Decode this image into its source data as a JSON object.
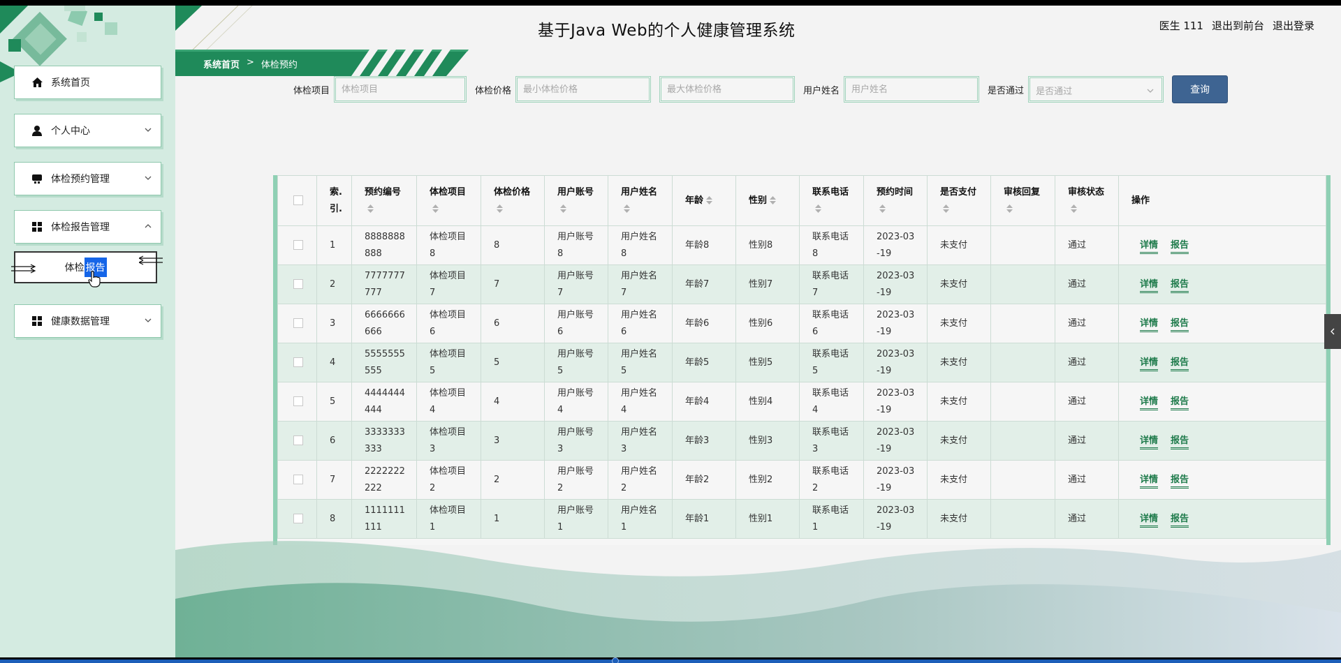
{
  "app": {
    "title": "基于Java Web的个人健康管理系统"
  },
  "header": {
    "user_label": "医生 111",
    "back_to_front": "退出到前台",
    "logout": "退出登录"
  },
  "colors": {
    "accent_green": "#1f8a5a",
    "sidebar_bg": "#d4ebe1",
    "query_button": "#3e6492",
    "link": "#1d7a4a"
  },
  "sidebar": {
    "items": [
      {
        "label": "系统首页",
        "icon": "home-icon"
      },
      {
        "label": "个人中心",
        "icon": "user-icon"
      },
      {
        "label": "体检预约管理",
        "icon": "calendar-icon"
      },
      {
        "label": "体检报告管理",
        "icon": "grid-icon"
      },
      {
        "label": "健康数据管理",
        "icon": "grid-icon"
      }
    ],
    "sub_item": {
      "label_prefix": "体检",
      "label_highlight": "报告"
    }
  },
  "breadcrumb": {
    "home": "系统首页",
    "separator": ">",
    "current": "体检预约"
  },
  "search": {
    "item_label": "体检项目",
    "item_placeholder": "体检项目",
    "price_label": "体检价格",
    "price_min_placeholder": "最小体检价格",
    "price_max_placeholder": "最大体检价格",
    "username_label": "用户姓名",
    "username_placeholder": "用户姓名",
    "passed_label": "是否通过",
    "passed_placeholder": "是否通过",
    "query_button": "查询"
  },
  "table": {
    "headers": [
      "索.引.",
      "预约编号",
      "体检项目",
      "体检价格",
      "用户账号",
      "用户姓名",
      "年龄",
      "性别",
      "联系电话",
      "预约时间",
      "是否支付",
      "审核回复",
      "审核状态",
      "操作"
    ],
    "detail_link": "详情",
    "report_link": "报告",
    "rows": [
      [
        "1",
        "8888888888",
        "体检项目8",
        "8",
        "用户账号8",
        "用户姓名8",
        "年龄8",
        "性别8",
        "联系电话8",
        "2023-03-19",
        "未支付",
        "",
        "通过"
      ],
      [
        "2",
        "7777777777",
        "体检项目7",
        "7",
        "用户账号7",
        "用户姓名7",
        "年龄7",
        "性别7",
        "联系电话7",
        "2023-03-19",
        "未支付",
        "",
        "通过"
      ],
      [
        "3",
        "6666666666",
        "体检项目6",
        "6",
        "用户账号6",
        "用户姓名6",
        "年龄6",
        "性别6",
        "联系电话6",
        "2023-03-19",
        "未支付",
        "",
        "通过"
      ],
      [
        "4",
        "5555555555",
        "体检项目5",
        "5",
        "用户账号5",
        "用户姓名5",
        "年龄5",
        "性别5",
        "联系电话5",
        "2023-03-19",
        "未支付",
        "",
        "通过"
      ],
      [
        "5",
        "4444444444",
        "体检项目4",
        "4",
        "用户账号4",
        "用户姓名4",
        "年龄4",
        "性别4",
        "联系电话4",
        "2023-03-19",
        "未支付",
        "",
        "通过"
      ],
      [
        "6",
        "3333333333",
        "体检项目3",
        "3",
        "用户账号3",
        "用户姓名3",
        "年龄3",
        "性别3",
        "联系电话3",
        "2023-03-19",
        "未支付",
        "",
        "通过"
      ],
      [
        "7",
        "2222222222",
        "体检项目2",
        "2",
        "用户账号2",
        "用户姓名2",
        "年龄2",
        "性别2",
        "联系电话2",
        "2023-03-19",
        "未支付",
        "",
        "通过"
      ],
      [
        "8",
        "1111111111",
        "体检项目1",
        "1",
        "用户账号1",
        "用户姓名1",
        "年龄1",
        "性别1",
        "联系电话1",
        "2023-03-19",
        "未支付",
        "",
        "通过"
      ]
    ]
  }
}
